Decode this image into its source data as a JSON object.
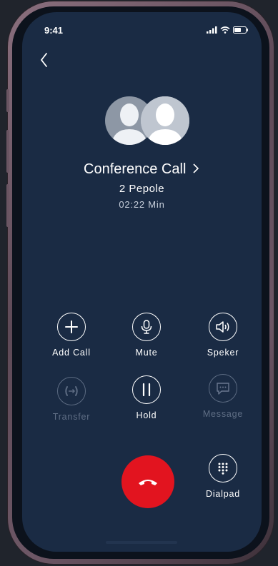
{
  "status_bar": {
    "time": "9:41"
  },
  "call": {
    "title": "Conference Call",
    "participants": "2 Pepole",
    "duration": "02:22 Min"
  },
  "controls": {
    "add_call": "Add Call",
    "mute": "Mute",
    "speaker": "Speker",
    "transfer": "Transfer",
    "hold": "Hold",
    "message": "Message",
    "dialpad": "Dialpad"
  },
  "colors": {
    "screen_bg": "#1a2b44",
    "end_call": "#e2141f",
    "disabled": "#5f6e85"
  },
  "icons": [
    "back-chevron-icon",
    "signal-icon",
    "wifi-icon",
    "battery-icon",
    "person-icon",
    "plus-icon",
    "microphone-icon",
    "speaker-icon",
    "transfer-icon",
    "pause-icon",
    "message-icon",
    "phone-hangup-icon",
    "dialpad-icon"
  ]
}
